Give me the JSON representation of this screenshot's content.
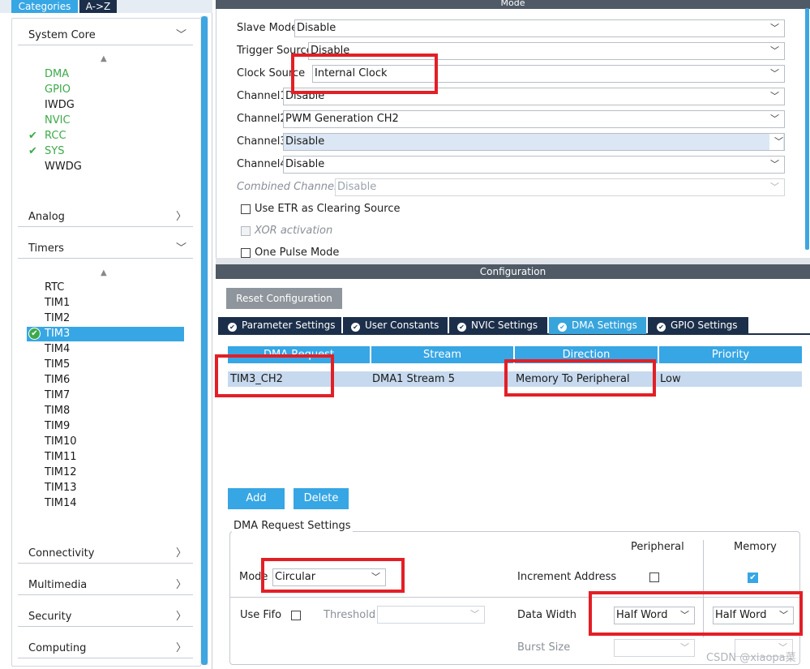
{
  "left": {
    "tabs": [
      "Categories",
      "A->Z"
    ],
    "system_core": {
      "title": "System Core",
      "items": [
        {
          "label": "DMA",
          "state": "green"
        },
        {
          "label": "GPIO",
          "state": "green"
        },
        {
          "label": "IWDG",
          "state": "normal"
        },
        {
          "label": "NVIC",
          "state": "green"
        },
        {
          "label": "RCC",
          "state": "checked"
        },
        {
          "label": "SYS",
          "state": "checked"
        },
        {
          "label": "WWDG",
          "state": "normal"
        }
      ]
    },
    "analog": "Analog",
    "timers": {
      "title": "Timers",
      "items": [
        "RTC",
        "TIM1",
        "TIM2",
        "TIM3",
        "TIM4",
        "TIM5",
        "TIM6",
        "TIM7",
        "TIM8",
        "TIM9",
        "TIM10",
        "TIM11",
        "TIM12",
        "TIM13",
        "TIM14"
      ],
      "selected": "TIM3"
    },
    "categories": [
      "Connectivity",
      "Multimedia",
      "Security",
      "Computing"
    ]
  },
  "mode": {
    "header": "Mode",
    "rows": [
      {
        "label": "Slave Mode",
        "value": "Disable"
      },
      {
        "label": "Trigger Source",
        "value": "Disable"
      },
      {
        "label": "Clock Source",
        "value": "Internal Clock"
      },
      {
        "label": "Channel1",
        "value": "Disable"
      },
      {
        "label": "Channel2",
        "value": "PWM Generation CH2"
      },
      {
        "label": "Channel3",
        "value": "Disable"
      },
      {
        "label": "Channel4",
        "value": "Disable"
      },
      {
        "label": "Combined Channels",
        "value": "Disable"
      }
    ],
    "checks": [
      {
        "label": "Use ETR as Clearing Source"
      },
      {
        "label": "XOR activation"
      },
      {
        "label": "One Pulse Mode"
      }
    ]
  },
  "config": {
    "header": "Configuration",
    "reset": "Reset Configuration",
    "tabs": [
      "Parameter Settings",
      "User Constants",
      "NVIC Settings",
      "DMA Settings",
      "GPIO Settings"
    ],
    "table": {
      "headers": [
        "DMA Request",
        "Stream",
        "Direction",
        "Priority"
      ],
      "rows": [
        [
          "TIM3_CH2",
          "DMA1 Stream 5",
          "Memory To Peripheral",
          "Low"
        ]
      ]
    },
    "add": "Add",
    "delete": "Delete",
    "dma_req": {
      "legend": "DMA Request Settings",
      "peripheral": "Peripheral",
      "memory": "Memory",
      "mode_label": "Mode",
      "mode_value": "Circular",
      "increment": "Increment Address",
      "use_fifo": "Use Fifo",
      "threshold": "Threshold",
      "data_width": "Data Width",
      "periph_width": "Half Word",
      "mem_width": "Half Word",
      "burst": "Burst Size"
    }
  },
  "watermark": "CSDN @xiaopa菜"
}
